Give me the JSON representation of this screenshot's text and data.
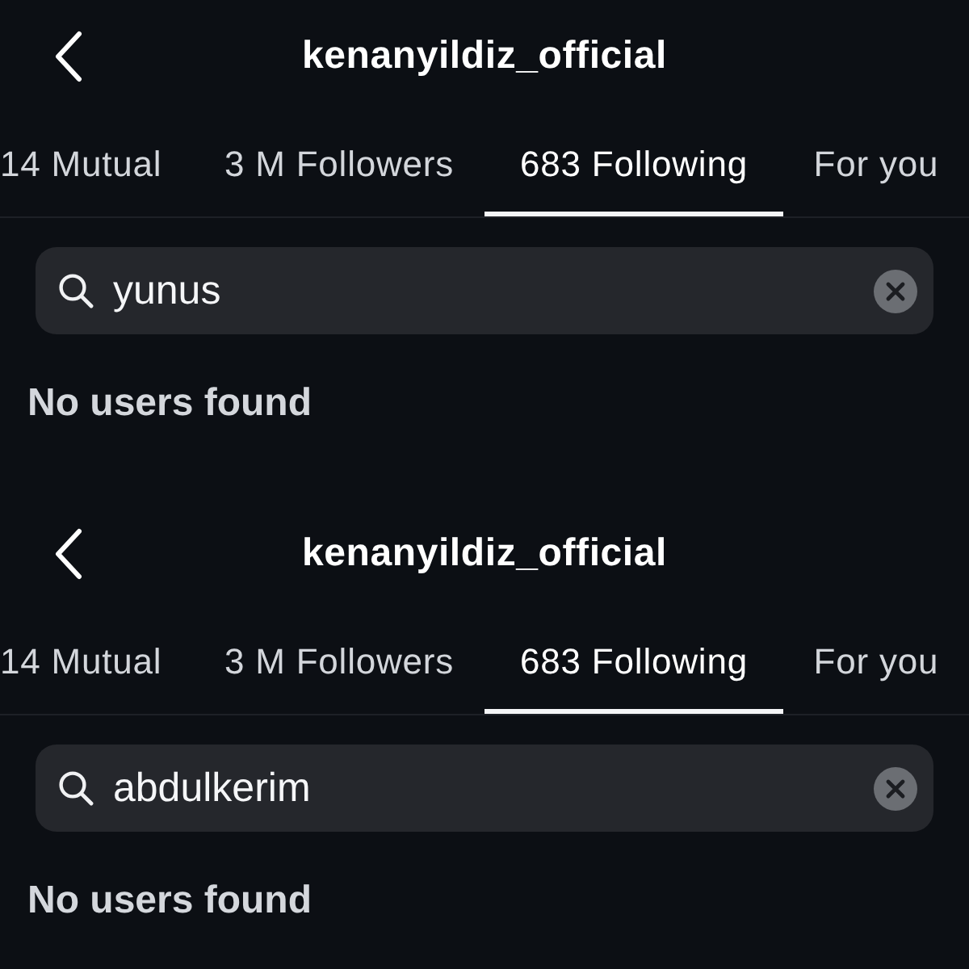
{
  "panels": [
    {
      "title": "kenanyildiz_official",
      "tabs": [
        {
          "label": "14 Mutual",
          "selected": false
        },
        {
          "label": "3 M Followers",
          "selected": false
        },
        {
          "label": "683 Following",
          "selected": true
        },
        {
          "label": "For you",
          "selected": false
        }
      ],
      "search": {
        "value": "yunus"
      },
      "empty_message": "No users found"
    },
    {
      "title": "kenanyildiz_official",
      "tabs": [
        {
          "label": "14 Mutual",
          "selected": false
        },
        {
          "label": "3 M Followers",
          "selected": false
        },
        {
          "label": "683 Following",
          "selected": true
        },
        {
          "label": "For you",
          "selected": false
        }
      ],
      "search": {
        "value": "abdulkerim"
      },
      "empty_message": "No users found"
    }
  ]
}
